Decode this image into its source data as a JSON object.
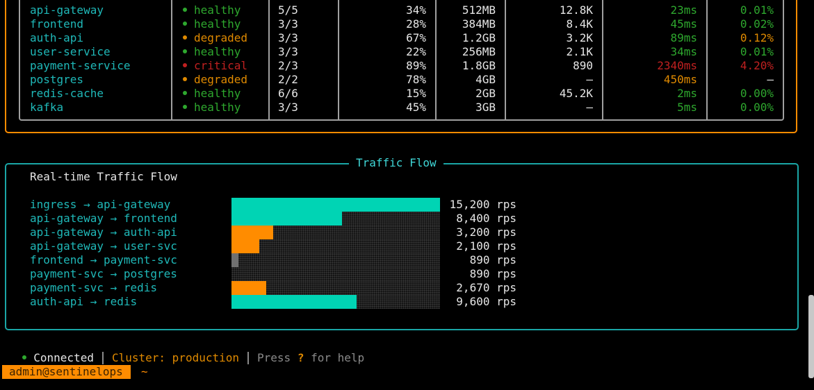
{
  "services": [
    {
      "name": "api-gateway",
      "status": "healthy",
      "status_color": "#2ea82e",
      "replicas": "5/5",
      "cpu": "34%",
      "memory": "512MB",
      "rps": "12.8K",
      "latency": "23ms",
      "latency_color": "#2ea82e",
      "errors": "0.01%",
      "errors_color": "#2ea82e"
    },
    {
      "name": "frontend",
      "status": "healthy",
      "status_color": "#2ea82e",
      "replicas": "3/3",
      "cpu": "28%",
      "memory": "384MB",
      "rps": "8.4K",
      "latency": "45ms",
      "latency_color": "#2ea82e",
      "errors": "0.02%",
      "errors_color": "#2ea82e"
    },
    {
      "name": "auth-api",
      "status": "degraded",
      "status_color": "#e08a00",
      "replicas": "3/3",
      "cpu": "67%",
      "memory": "1.2GB",
      "rps": "3.2K",
      "latency": "89ms",
      "latency_color": "#2ea82e",
      "errors": "0.12%",
      "errors_color": "#e08a00"
    },
    {
      "name": "user-service",
      "status": "healthy",
      "status_color": "#2ea82e",
      "replicas": "3/3",
      "cpu": "22%",
      "memory": "256MB",
      "rps": "2.1K",
      "latency": "34ms",
      "latency_color": "#2ea82e",
      "errors": "0.01%",
      "errors_color": "#2ea82e"
    },
    {
      "name": "payment-service",
      "status": "critical",
      "status_color": "#c02020",
      "replicas": "2/3",
      "cpu": "89%",
      "memory": "1.8GB",
      "rps": "890",
      "latency": "2340ms",
      "latency_color": "#c02020",
      "errors": "4.20%",
      "errors_color": "#c02020"
    },
    {
      "name": "postgres",
      "status": "degraded",
      "status_color": "#e08a00",
      "replicas": "2/2",
      "cpu": "78%",
      "memory": "4GB",
      "rps": "—",
      "latency": "450ms",
      "latency_color": "#e08a00",
      "errors": "—",
      "errors_color": "#e6e6e6"
    },
    {
      "name": "redis-cache",
      "status": "healthy",
      "status_color": "#2ea82e",
      "replicas": "6/6",
      "cpu": "15%",
      "memory": "2GB",
      "rps": "45.2K",
      "latency": "2ms",
      "latency_color": "#2ea82e",
      "errors": "0.00%",
      "errors_color": "#2ea82e"
    },
    {
      "name": "kafka",
      "status": "healthy",
      "status_color": "#2ea82e",
      "replicas": "3/3",
      "cpu": "45%",
      "memory": "3GB",
      "rps": "—",
      "latency": "5ms",
      "latency_color": "#2ea82e",
      "errors": "0.00%",
      "errors_color": "#2ea82e"
    }
  ],
  "traffic": {
    "panel_title": "Traffic Flow",
    "heading": "Real-time Traffic Flow",
    "flows": [
      {
        "label": "ingress → api-gateway",
        "rps": "15,200 rps",
        "level": 1.0,
        "color": "#00d4b4"
      },
      {
        "label": "api-gateway → frontend",
        "rps": "8,400 rps",
        "level": 0.53,
        "color": "#00d4b4"
      },
      {
        "label": "api-gateway → auth-api",
        "rps": "3,200 rps",
        "level": 0.2,
        "color": "#ff8c00"
      },
      {
        "label": "api-gateway → user-svc",
        "rps": "2,100 rps",
        "level": 0.133,
        "color": "#ff8c00"
      },
      {
        "label": "frontend → payment-svc",
        "rps": "890 rps",
        "level": 0.033,
        "color": "#707070"
      },
      {
        "label": "payment-svc → postgres",
        "rps": "890 rps",
        "level": 0.0,
        "color": "#707070"
      },
      {
        "label": "payment-svc → redis",
        "rps": "2,670 rps",
        "level": 0.167,
        "color": "#ff8c00"
      },
      {
        "label": "auth-api → redis",
        "rps": "9,600 rps",
        "level": 0.6,
        "color": "#00d4b4"
      }
    ]
  },
  "status_bar": {
    "connected": "Connected",
    "cluster_label": "Cluster:",
    "cluster_value": "production",
    "help_prefix": "Press",
    "help_key": "?",
    "help_suffix": "for help"
  },
  "prompt": {
    "user_host": "admin@sentinelops",
    "dir": "~"
  },
  "colors": {
    "accent_orange": "#ff8c00",
    "accent_teal": "#1fb8b8",
    "healthy": "#2ea82e",
    "degraded": "#e08a00",
    "critical": "#c02020"
  }
}
